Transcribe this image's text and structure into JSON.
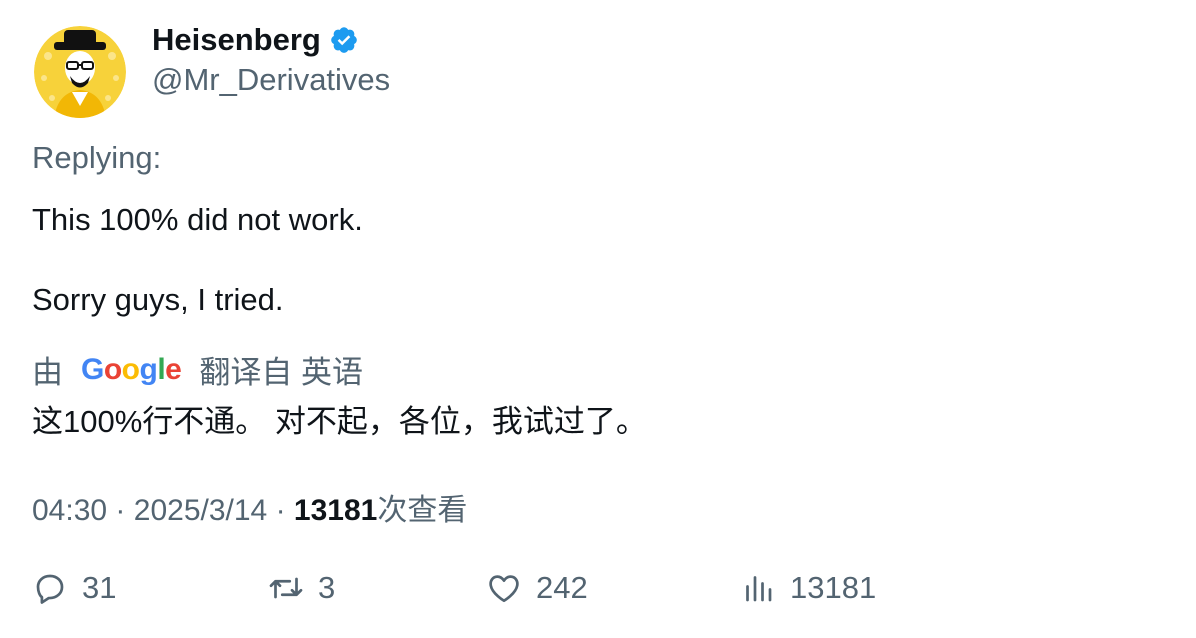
{
  "author": {
    "display_name": "Heisenberg",
    "handle": "@Mr_Derivatives",
    "verified": true,
    "avatar_icon": "heisenberg-avatar-icon"
  },
  "tweet": {
    "replying_label": "Replying:",
    "lines": [
      "This 100% did not work.",
      "Sorry guys, I tried."
    ]
  },
  "translation": {
    "prefix": "由",
    "provider_letters": [
      "G",
      "o",
      "o",
      "g",
      "l",
      "e"
    ],
    "provider_colors": [
      "#4285F4",
      "#EA4335",
      "#FBBC05",
      "#4285F4",
      "#34A853",
      "#EA4335"
    ],
    "suffix": "翻译自 英语",
    "text": "这100%行不通。 对不起，各位，我试过了。"
  },
  "meta": {
    "time": "04:30",
    "separator": "·",
    "date": "2025/3/14",
    "views_count": "13181",
    "views_label": "次查看"
  },
  "actions": {
    "replies": "31",
    "retweets": "3",
    "likes": "242",
    "views": "13181"
  },
  "colors": {
    "primary_text": "#0f1419",
    "secondary_text": "#536471",
    "verified_blue": "#1d9bf0",
    "avatar_yellow": "#f7d23a"
  }
}
